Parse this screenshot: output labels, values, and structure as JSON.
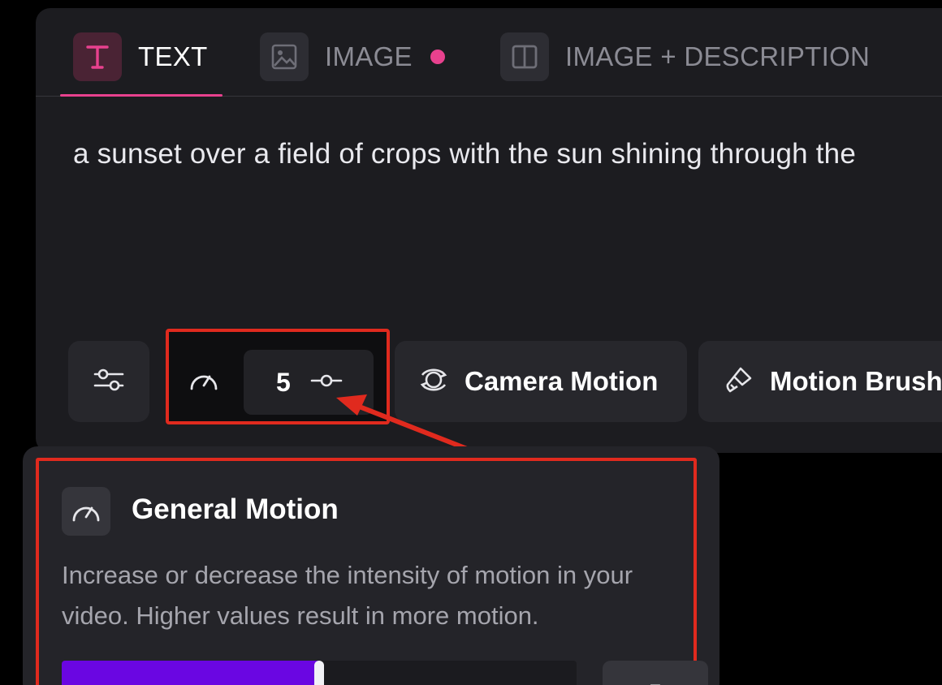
{
  "tabs": [
    {
      "label": "TEXT",
      "icon": "text-t-icon",
      "active": true
    },
    {
      "label": "IMAGE",
      "icon": "image-icon",
      "active": false,
      "has_dot": true
    },
    {
      "label": "IMAGE + DESCRIPTION",
      "icon": "split-panel-icon",
      "active": false
    }
  ],
  "prompt": {
    "text": "a sunset over a field of crops with the sun shining through the"
  },
  "toolbar": {
    "settings_icon": "sliders-icon",
    "general_motion_value": "5",
    "camera_motion_label": "Camera Motion",
    "motion_brush_label": "Motion Brush"
  },
  "popover": {
    "title": "General Motion",
    "description": "Increase or decrease the intensity of motion in your video. Higher values result in more motion.",
    "slider_value": "5",
    "slider_fraction": 0.5
  },
  "colors": {
    "accent_pink": "#e8418e",
    "highlight_red": "#e02a1e",
    "slider_purple": "#6a06e2",
    "card_bg": "#1c1c20"
  }
}
